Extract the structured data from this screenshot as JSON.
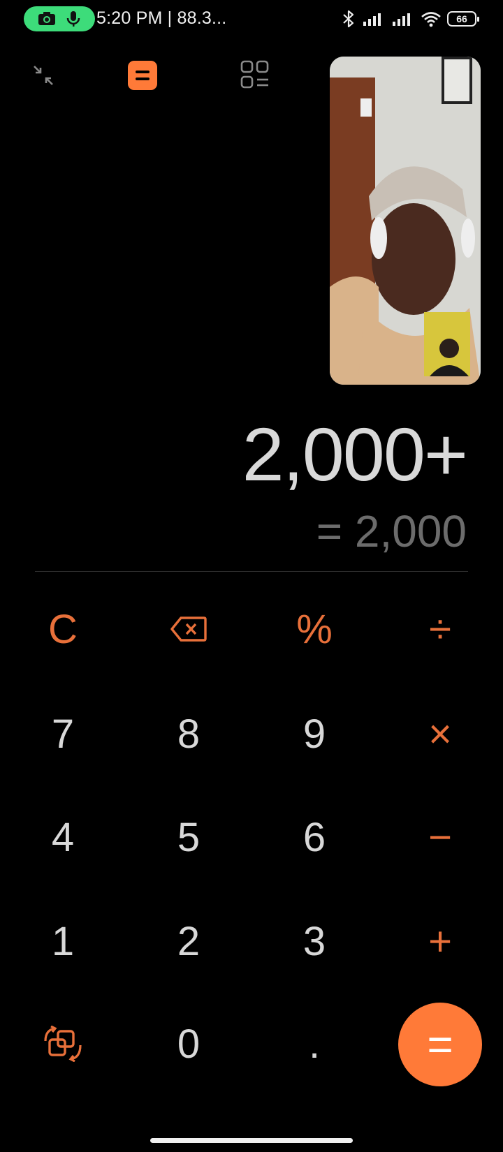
{
  "status_bar": {
    "time_text": "5:20 PM | 88.3...",
    "battery": "66"
  },
  "display": {
    "expression": "2,000+",
    "result": "= 2,000"
  },
  "keypad": {
    "clear": "C",
    "percent": "%",
    "divide": "÷",
    "multiply": "×",
    "minus": "−",
    "plus": "+",
    "equals": "=",
    "dot": ".",
    "d0": "0",
    "d1": "1",
    "d2": "2",
    "d3": "3",
    "d4": "4",
    "d5": "5",
    "d6": "6",
    "d7": "7",
    "d8": "8",
    "d9": "9"
  },
  "colors": {
    "accent": "#ff7a38",
    "operator": "#e8703a",
    "background": "#000000",
    "recording_pill": "#3ddc7a"
  },
  "icons": [
    "camera-icon",
    "microphone-icon",
    "bluetooth-icon",
    "signal-icon",
    "wifi-icon",
    "battery-icon",
    "collapse-icon",
    "calculator-mode-icon",
    "menu-grid-icon",
    "backspace-icon",
    "switch-mode-icon"
  ]
}
